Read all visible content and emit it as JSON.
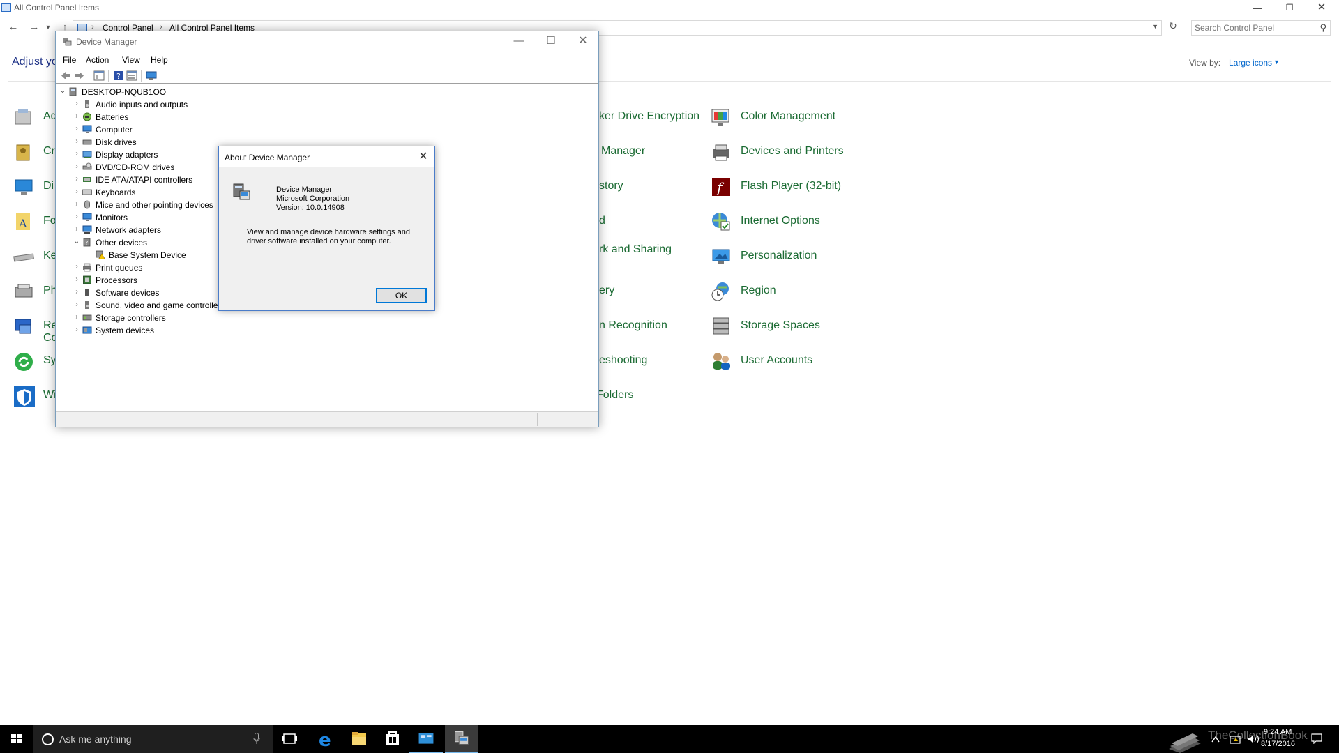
{
  "control_panel": {
    "window_title": "All Control Panel Items",
    "breadcrumb": [
      "Control Panel",
      "All Control Panel Items"
    ],
    "search_placeholder": "Search Control Panel",
    "heading_visible": "Adjust yo",
    "view_by_label": "View by:",
    "view_by_value": "Large icons",
    "left_column_fragments": [
      "Ad",
      "Cr",
      "Di",
      "Fo",
      "Ke",
      "Ph",
      "Re",
      "Co",
      "Sy",
      "Wi"
    ],
    "middle_column_fragments": [
      "ker Drive Encryption",
      "Manager",
      "story",
      "d",
      "rk and Sharing",
      "ery",
      "n Recognition",
      "eshooting",
      "Folders"
    ],
    "right_column_items": [
      "Color Management",
      "Devices and Printers",
      "Flash Player (32-bit)",
      "Internet Options",
      "Personalization",
      "Region",
      "Storage Spaces",
      "User Accounts"
    ]
  },
  "device_manager": {
    "title": "Device Manager",
    "menu": [
      "File",
      "Action",
      "View",
      "Help"
    ],
    "root": "DESKTOP-NQUB1OO",
    "nodes": [
      "Audio inputs and outputs",
      "Batteries",
      "Computer",
      "Disk drives",
      "Display adapters",
      "DVD/CD-ROM drives",
      "IDE ATA/ATAPI controllers",
      "Keyboards",
      "Mice and other pointing devices",
      "Monitors",
      "Network adapters",
      "Other devices",
      "Base System Device",
      "Print queues",
      "Processors",
      "Software devices",
      "Sound, video and game controllers",
      "Storage controllers",
      "System devices"
    ]
  },
  "about_dialog": {
    "title": "About Device Manager",
    "product": "Device Manager",
    "company": "Microsoft Corporation",
    "version": "Version: 10.0.14908",
    "description": "View and manage device hardware settings and driver software installed on your computer.",
    "ok_label": "OK"
  },
  "taskbar": {
    "search_placeholder": "Ask me anything",
    "watermark": "TheCollectionBook",
    "time": "9:24 AM",
    "date": "8/17/2016"
  },
  "colors": {
    "link_green": "#1b6b33",
    "accent_blue": "#0078d7",
    "taskbar": "#000000"
  }
}
